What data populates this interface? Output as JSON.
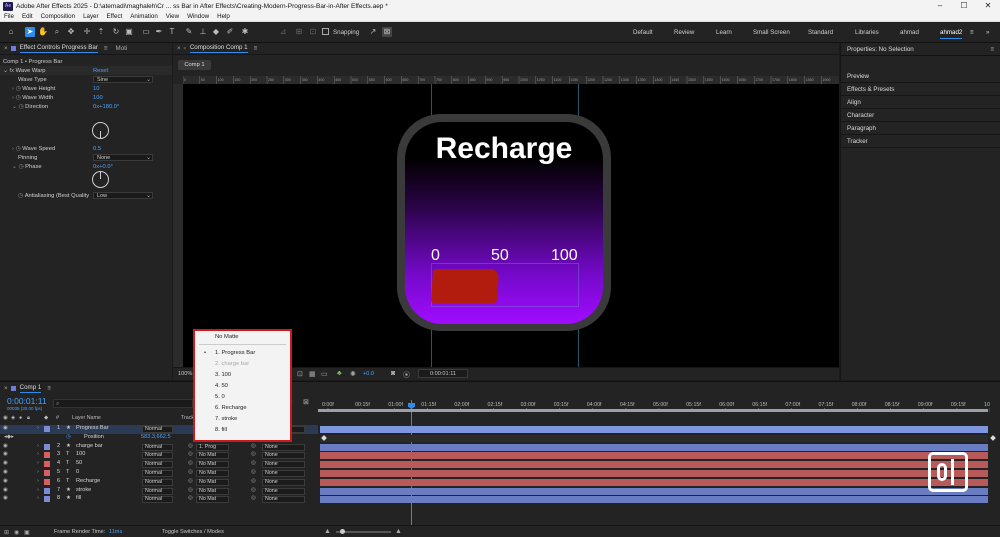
{
  "titlebar": {
    "title": "Adobe After Effects 2025 - D:\\atemadi\\maghaleh\\Cr ... ss Bar in After Effects\\Creating-Modern-Progress-Bar-in-After Effects.aep *"
  },
  "menu": [
    "File",
    "Edit",
    "Composition",
    "Layer",
    "Effect",
    "Animation",
    "View",
    "Window",
    "Help"
  ],
  "toolbar": {
    "snapping": "Snapping"
  },
  "workspaces": [
    "Default",
    "Review",
    "Learn",
    "Small Screen",
    "Standard",
    "Libraries",
    "ahmad",
    "ahmad2"
  ],
  "effects_panel": {
    "tab": "Effect Controls Progress Bar",
    "tab2": "Moti",
    "comp_layer": "Comp 1 • Progress Bar",
    "effect_name": "Wave Warp",
    "reset": "Reset",
    "props": [
      {
        "label": "Wave Type",
        "value": "Sine",
        "kind": "dd"
      },
      {
        "label": "Wave Height",
        "value": "10",
        "kind": "val"
      },
      {
        "label": "Wave Width",
        "value": "100",
        "kind": "val"
      },
      {
        "label": "Direction",
        "value": "0x+180.0°",
        "kind": "val"
      },
      {
        "label": "Wave Speed",
        "value": "0.5",
        "kind": "val"
      },
      {
        "label": "Pinning",
        "value": "None",
        "kind": "dd"
      },
      {
        "label": "Phase",
        "value": "0x+0.0°",
        "kind": "val"
      },
      {
        "label": "Antialiasing (Best Quality",
        "value": "Low",
        "kind": "dd"
      }
    ]
  },
  "comp_panel": {
    "tab": "Composition Comp 1",
    "comp_tab": "Comp 1",
    "zoom": "100%",
    "timecode": "0:00:01:11",
    "exposure": "+0.0"
  },
  "comp_view": {
    "title": "Recharge",
    "ticks": [
      "0",
      "50",
      "100"
    ],
    "progress": 0.45,
    "ruler_labels": [
      "0",
      "50",
      "100",
      "150",
      "200",
      "250",
      "300",
      "350",
      "400",
      "450",
      "500",
      "550",
      "600",
      "650",
      "700",
      "750",
      "800",
      "850",
      "900",
      "950",
      "1000",
      "1050",
      "1100",
      "1150",
      "1200",
      "1250",
      "1300",
      "1350",
      "1400",
      "1450",
      "1500",
      "1550",
      "1600",
      "1650",
      "1700",
      "1750",
      "1800",
      "1850",
      "1900"
    ],
    "colors": {
      "card_top": "#000000",
      "card_bottom": "#a00cff",
      "bezel": "#3a3a3a",
      "fill": "#b21c0f"
    }
  },
  "right_panel": {
    "header": "Properties: No Selection",
    "items": [
      "Preview",
      "Effects & Presets",
      "Align",
      "Character",
      "Paragraph",
      "Tracker"
    ]
  },
  "timeline": {
    "tab": "Comp 1",
    "time": "0:00:01:11",
    "fps": "00035 (30.00 fps)",
    "search_placeholder": "",
    "col_num": "#",
    "col_layer": "Layer Name",
    "col_track": "Track",
    "position_label": "Position",
    "position_value": "583.3,662.5",
    "ruler": [
      "0:00f",
      "00:15f",
      "01:00f",
      "01:15f",
      "02:00f",
      "02:15f",
      "03:00f",
      "03:15f",
      "04:00f",
      "04:15f",
      "05:00f",
      "05:15f",
      "06:00f",
      "06:15f",
      "07:00f",
      "07:15f",
      "08:00f",
      "08:15f",
      "09:00f",
      "09:15f",
      "10:0"
    ],
    "layers": [
      {
        "num": "1",
        "icon": "★",
        "name": "Progress Bar",
        "mode": "Normal",
        "track": "",
        "parent": "None",
        "color": "#7b8bd6",
        "bar": "#7e96df"
      },
      {
        "num": "2",
        "icon": "★",
        "name": "charge bar",
        "mode": "Normal",
        "track": "1. Prog",
        "parent": "None",
        "color": "#7b8bd6",
        "bar": "#6a7dc2"
      },
      {
        "num": "3",
        "icon": "T",
        "name": "100",
        "mode": "Normal",
        "track": "No Mat",
        "parent": "None",
        "color": "#d66060",
        "bar": "#b85a5a"
      },
      {
        "num": "4",
        "icon": "T",
        "name": "50",
        "mode": "Normal",
        "track": "No Mat",
        "parent": "None",
        "color": "#d66060",
        "bar": "#b85a5a"
      },
      {
        "num": "5",
        "icon": "T",
        "name": "0",
        "mode": "Normal",
        "track": "No Mat",
        "parent": "None",
        "color": "#d66060",
        "bar": "#b85a5a"
      },
      {
        "num": "6",
        "icon": "T",
        "name": "Recharge",
        "mode": "Normal",
        "track": "No Mat",
        "parent": "None",
        "color": "#d66060",
        "bar": "#b85a5a"
      },
      {
        "num": "7",
        "icon": "★",
        "name": "stroke",
        "mode": "Normal",
        "track": "No Mat",
        "parent": "None",
        "color": "#7b8bd6",
        "bar": "#6a7dc2"
      },
      {
        "num": "8",
        "icon": "★",
        "name": "fill",
        "mode": "Normal",
        "track": "No Mat",
        "parent": "None",
        "color": "#7b8bd6",
        "bar": "#6a7dc2"
      }
    ],
    "footer_render": "Frame Render Time:",
    "footer_render_value": "11ms",
    "footer_toggle": "Toggle Switches / Modes"
  },
  "dropdown": {
    "items": [
      {
        "label": "No Matte",
        "state": "normal"
      },
      {
        "label": "1. Progress Bar",
        "state": "selected"
      },
      {
        "label": "2. charge bar",
        "state": "disabled"
      },
      {
        "label": "3. 100",
        "state": "normal"
      },
      {
        "label": "4. 50",
        "state": "normal"
      },
      {
        "label": "5. 0",
        "state": "normal"
      },
      {
        "label": "6. Recharge",
        "state": "normal"
      },
      {
        "label": "7. stroke",
        "state": "normal"
      },
      {
        "label": "8. fill",
        "state": "normal"
      }
    ]
  }
}
